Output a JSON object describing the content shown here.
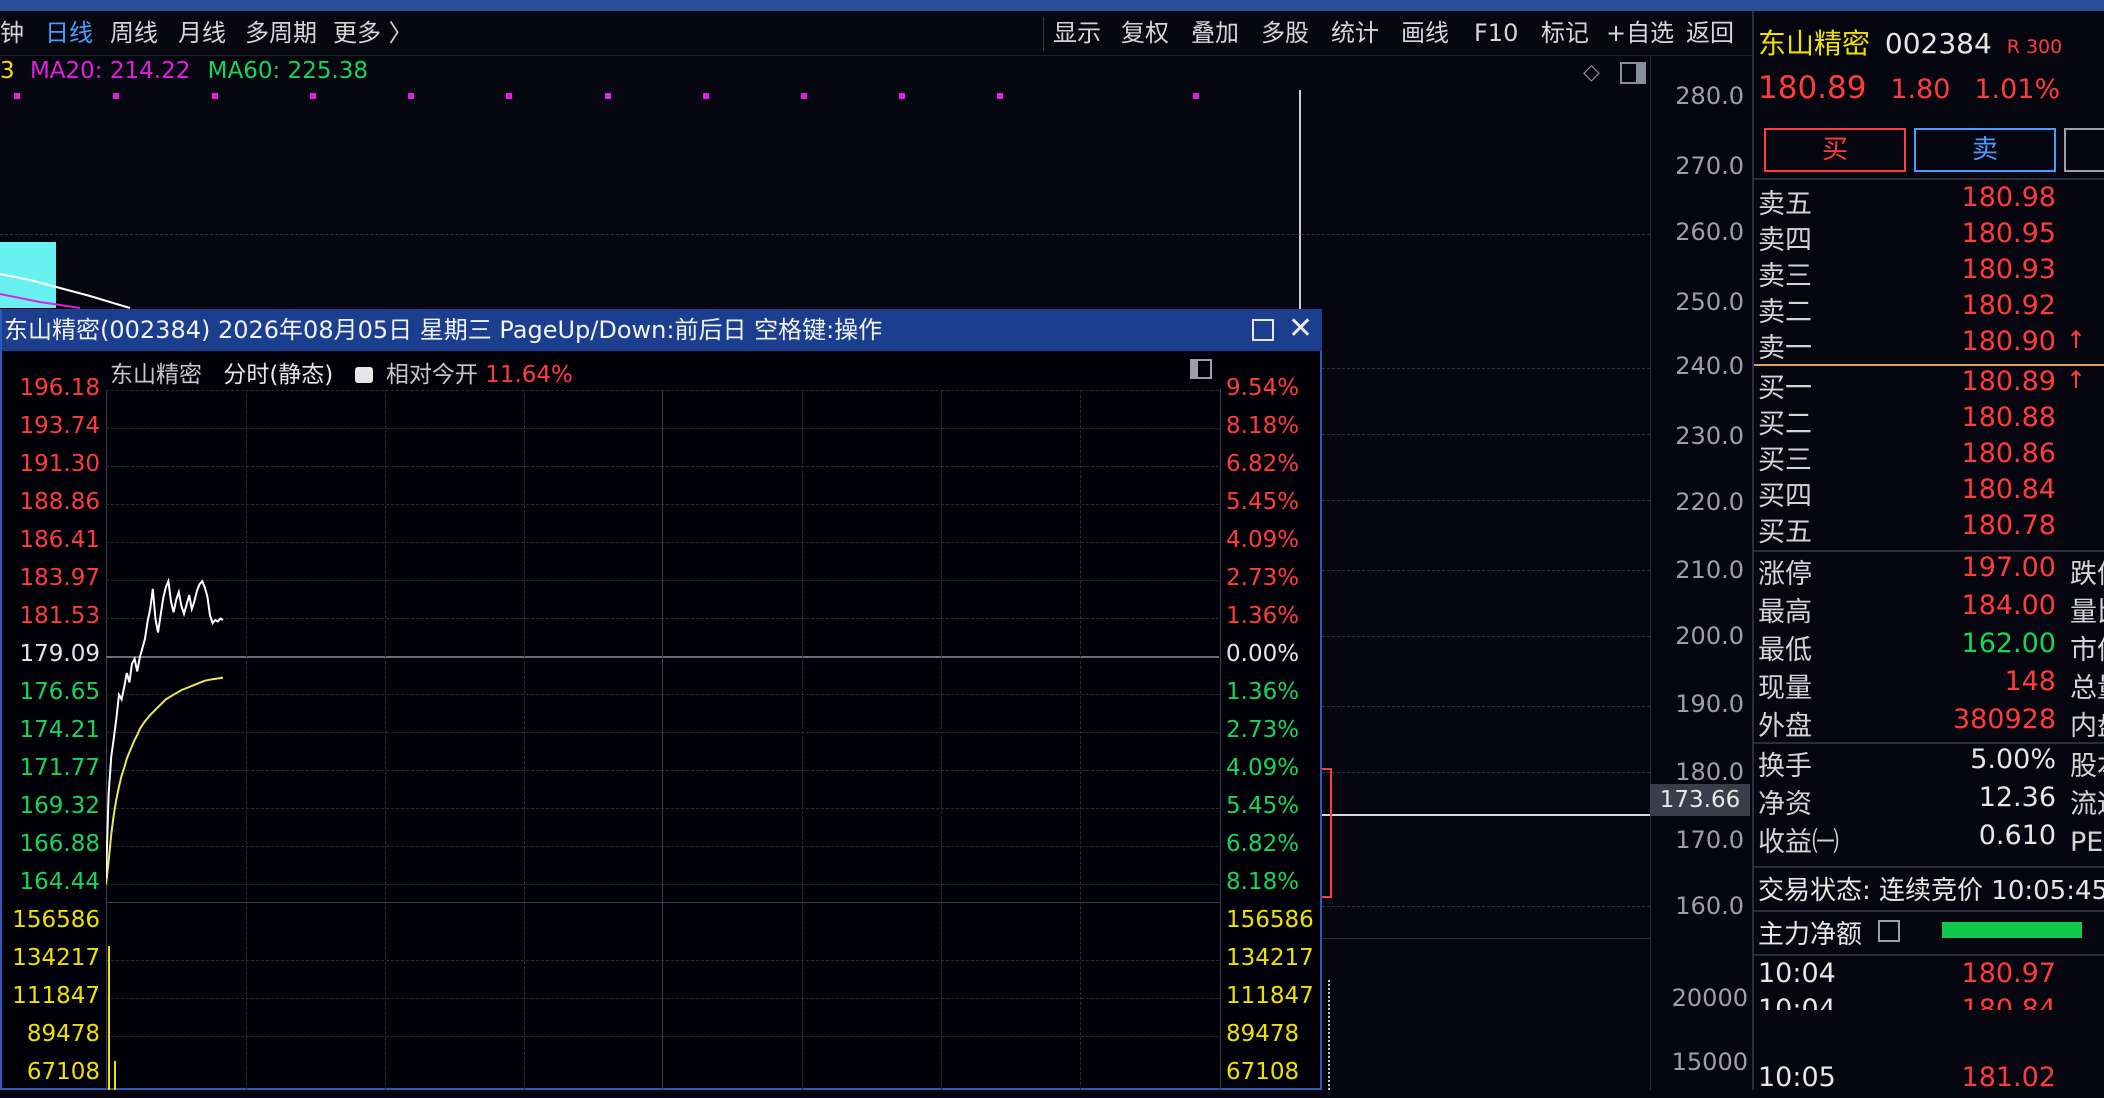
{
  "toolbar": {
    "left_items": [
      "钟",
      "日线",
      "周线",
      "月线",
      "多周期",
      "更多 〉"
    ],
    "active_item": "日线",
    "right_items": [
      "显示",
      "复权",
      "叠加",
      "多股",
      "统计",
      "画线",
      "F10",
      "标记",
      "+自选",
      "返回"
    ]
  },
  "ma_legend": {
    "ma_prefix": "3",
    "ma20": "MA20: 214.22",
    "ma60": "MA60: 225.38"
  },
  "kline_axis": {
    "price_ticks": [
      "280.0",
      "270.0",
      "260.0",
      "250.0",
      "240.0",
      "230.0",
      "220.0",
      "210.0",
      "200.0",
      "190.0",
      "180.0",
      "170.0",
      "160.0"
    ],
    "crosshair_price": "173.66",
    "volume_ticks": [
      "20000",
      "15000"
    ]
  },
  "stock": {
    "name": "东山精密",
    "code": "002384",
    "badge": "R 300",
    "price": "180.89",
    "change": "1.80",
    "change_pct": "1.01%",
    "buy_label": "买",
    "sell_label": "卖"
  },
  "order_book": {
    "asks": [
      {
        "label": "卖五",
        "price": "180.98",
        "arrow": ""
      },
      {
        "label": "卖四",
        "price": "180.95",
        "arrow": ""
      },
      {
        "label": "卖三",
        "price": "180.93",
        "arrow": ""
      },
      {
        "label": "卖二",
        "price": "180.92",
        "arrow": ""
      },
      {
        "label": "卖一",
        "price": "180.90",
        "arrow": "↑"
      }
    ],
    "bids": [
      {
        "label": "买一",
        "price": "180.89",
        "arrow": "↑"
      },
      {
        "label": "买二",
        "price": "180.88",
        "arrow": ""
      },
      {
        "label": "买三",
        "price": "180.86",
        "arrow": ""
      },
      {
        "label": "买四",
        "price": "180.84",
        "arrow": ""
      },
      {
        "label": "买五",
        "price": "180.78",
        "arrow": ""
      }
    ]
  },
  "stats": [
    {
      "label": "涨停",
      "value": "197.00",
      "color": "red",
      "extra": "跌停"
    },
    {
      "label": "最高",
      "value": "184.00",
      "color": "red",
      "extra": "量比"
    },
    {
      "label": "最低",
      "value": "162.00",
      "color": "green",
      "extra": "市值"
    },
    {
      "label": "现量",
      "value": "148",
      "color": "red",
      "extra": "总量"
    },
    {
      "label": "外盘",
      "value": "380928",
      "color": "red",
      "extra": "内盘"
    },
    {
      "label": "换手",
      "value": "5.00%",
      "color": "white",
      "extra": "股本"
    },
    {
      "label": "净资",
      "value": "12.36",
      "color": "white",
      "extra": "流通"
    },
    {
      "label": "收益㈠",
      "value": "0.610",
      "color": "white",
      "extra": "PE(动)"
    }
  ],
  "trade_status": "交易状态: 连续竞价 10:05:45",
  "main_flow_label": "主力净额",
  "ticks": [
    {
      "time": "10:04",
      "price": "180.97"
    },
    {
      "time": "10:04",
      "price": "180.84"
    },
    {
      "time": "10:05",
      "price": "181.02"
    }
  ],
  "popup": {
    "title": "东山精密(002384) 2026年08月05日 星期三 PageUp/Down:前后日 空格键:操作",
    "stock_name": "东山精密",
    "mode": "分时(静态)",
    "relative_label": "相对今开",
    "relative_value": "11.64%",
    "price_labels": [
      "196.18",
      "193.74",
      "191.30",
      "188.86",
      "186.41",
      "183.97",
      "181.53",
      "179.09",
      "176.65",
      "174.21",
      "171.77",
      "169.32",
      "166.88",
      "164.44"
    ],
    "pct_labels": [
      "9.54%",
      "8.18%",
      "6.82%",
      "5.45%",
      "4.09%",
      "2.73%",
      "1.36%",
      "0.00%",
      "1.36%",
      "2.73%",
      "4.09%",
      "5.45%",
      "6.82%",
      "8.18%"
    ],
    "volume_labels": [
      "156586",
      "134217",
      "111847",
      "89478",
      "67108"
    ],
    "price_line": [
      [
        0,
        164.8
      ],
      [
        2,
        170.2
      ],
      [
        4,
        172.6
      ],
      [
        6,
        173.8
      ],
      [
        8,
        175.1
      ],
      [
        10,
        176.6
      ],
      [
        12,
        176.3
      ],
      [
        14,
        177.1
      ],
      [
        16,
        178.0
      ],
      [
        18,
        177.4
      ],
      [
        20,
        178.6
      ],
      [
        22,
        178.9
      ],
      [
        24,
        178.1
      ],
      [
        26,
        179.0
      ],
      [
        28,
        179.6
      ],
      [
        30,
        180.2
      ],
      [
        32,
        181.3
      ],
      [
        34,
        182.1
      ],
      [
        36,
        183.4
      ],
      [
        38,
        181.5
      ],
      [
        40,
        180.6
      ],
      [
        42,
        181.7
      ],
      [
        44,
        182.8
      ],
      [
        46,
        183.5
      ],
      [
        48,
        183.9
      ],
      [
        50,
        182.6
      ],
      [
        52,
        181.9
      ],
      [
        54,
        182.7
      ],
      [
        56,
        183.2
      ],
      [
        58,
        182.3
      ],
      [
        60,
        181.8
      ],
      [
        62,
        182.4
      ],
      [
        64,
        183.0
      ],
      [
        66,
        182.1
      ],
      [
        68,
        182.6
      ],
      [
        70,
        183.3
      ],
      [
        72,
        183.7
      ],
      [
        74,
        183.9
      ],
      [
        76,
        183.5
      ],
      [
        78,
        182.9
      ],
      [
        80,
        181.7
      ],
      [
        82,
        181.2
      ],
      [
        84,
        181.4
      ],
      [
        86,
        181.3
      ],
      [
        88,
        181.5
      ],
      [
        90,
        181.4
      ]
    ],
    "avg_line": [
      [
        0,
        164.4
      ],
      [
        2,
        165.9
      ],
      [
        4,
        167.6
      ],
      [
        6,
        168.9
      ],
      [
        8,
        169.9
      ],
      [
        10,
        170.7
      ],
      [
        12,
        171.4
      ],
      [
        14,
        171.9
      ],
      [
        16,
        172.5
      ],
      [
        18,
        172.9
      ],
      [
        20,
        173.3
      ],
      [
        22,
        173.7
      ],
      [
        24,
        174.0
      ],
      [
        26,
        174.4
      ],
      [
        30,
        174.9
      ],
      [
        34,
        175.3
      ],
      [
        40,
        175.8
      ],
      [
        46,
        176.3
      ],
      [
        52,
        176.6
      ],
      [
        58,
        176.9
      ],
      [
        64,
        177.1
      ],
      [
        70,
        177.3
      ],
      [
        76,
        177.5
      ],
      [
        82,
        177.6
      ],
      [
        90,
        177.7
      ]
    ]
  },
  "colors": {
    "up": "#ff3b3b",
    "down": "#14d65a",
    "accent_blue": "#2c5bb6",
    "ma_magenta": "#e020e0"
  }
}
